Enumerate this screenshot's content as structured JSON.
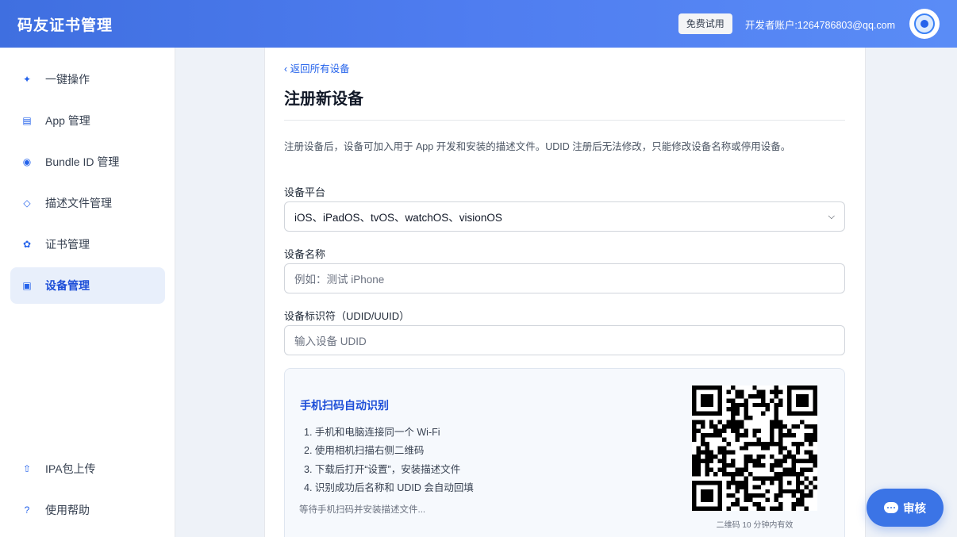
{
  "header": {
    "app_title": "码友证书管理",
    "trial_button": "免费试用",
    "account": "开发者账户:1264786803@qq.com"
  },
  "sidebar": {
    "items": [
      {
        "label": "一键操作",
        "icon": "sparkle-icon",
        "glyph": "✦"
      },
      {
        "label": "App 管理",
        "icon": "list-icon",
        "glyph": "▤"
      },
      {
        "label": "Bundle ID 管理",
        "icon": "radio-icon",
        "glyph": "◉"
      },
      {
        "label": "描述文件管理",
        "icon": "diamond-icon",
        "glyph": "◇"
      },
      {
        "label": "证书管理",
        "icon": "flower-icon",
        "glyph": "✿"
      },
      {
        "label": "设备管理",
        "icon": "device-icon",
        "glyph": "▣",
        "active": true
      }
    ],
    "bottom_items": [
      {
        "label": "IPA包上传",
        "icon": "upload-arrow-icon",
        "glyph": "⇧"
      },
      {
        "label": "使用帮助",
        "icon": "help-icon",
        "glyph": "?"
      }
    ]
  },
  "main": {
    "back_link": "‹ 返回所有设备",
    "title": "注册新设备",
    "description": "注册设备后，设备可加入用于 App 开发和安装的描述文件。UDID 注册后无法修改，只能修改设备名称或停用设备。",
    "platform_label": "设备平台",
    "platform_value": "iOS、iPadOS、tvOS、watchOS、visionOS",
    "name_label": "设备名称",
    "name_placeholder": "例如：测试 iPhone",
    "udid_label": "设备标识符（UDID/UUID）",
    "udid_placeholder": "输入设备 UDID"
  },
  "scan": {
    "title": "手机扫码自动识别",
    "steps": [
      "1. 手机和电脑连接同一个 Wi-Fi",
      "2. 使用相机扫描右侧二维码",
      "3. 下载后打开“设置”，安装描述文件",
      "4. 识别成功后名称和 UDID 会自动回填"
    ],
    "waiting": "等待手机扫码并安装描述文件...",
    "qr_note": "二维码 10 分钟内有效"
  },
  "review_button": "审核",
  "colors": {
    "accent": "#3b74e6",
    "header_start": "#3f6fe0",
    "active_bg": "#e8effb"
  }
}
